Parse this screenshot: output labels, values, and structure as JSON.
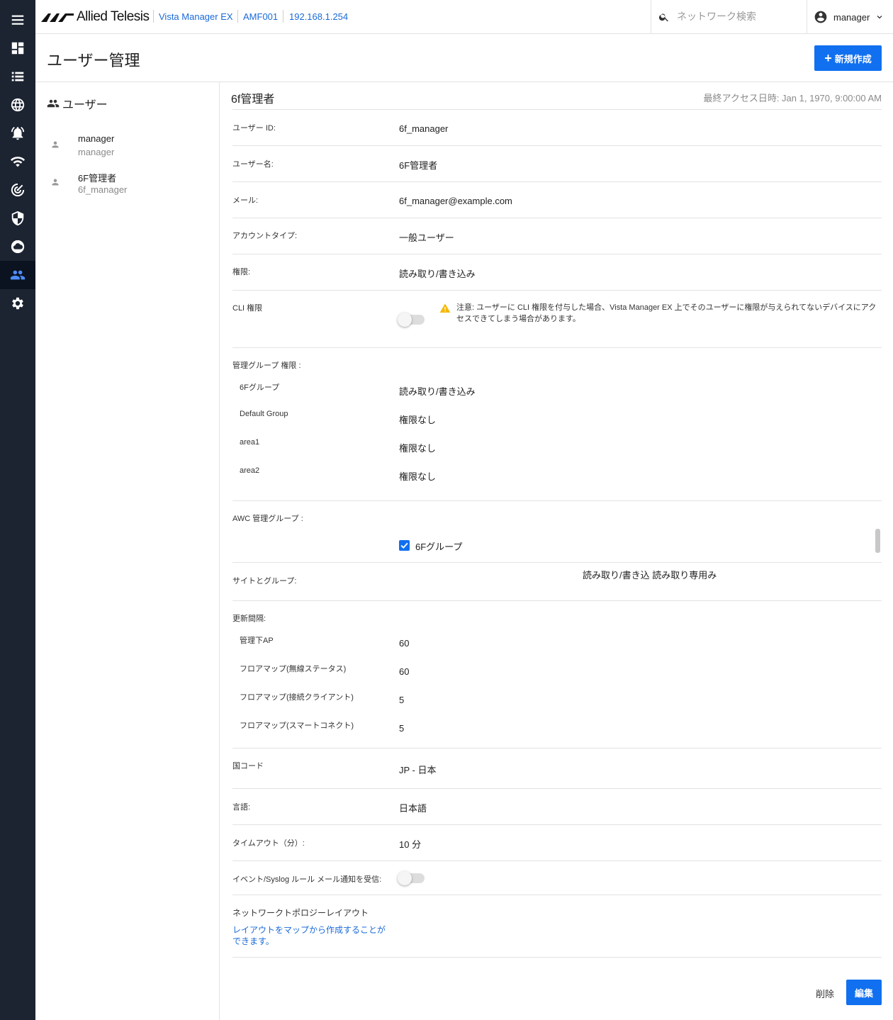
{
  "topbar": {
    "logo_text": "Allied Telesis",
    "crumbs": [
      "Vista Manager EX",
      "AMF001",
      "192.168.1.254"
    ],
    "search_placeholder": "ネットワーク検索",
    "user_name": "manager"
  },
  "page": {
    "title": "ユーザー管理",
    "new_button": "新規作成"
  },
  "user_list": {
    "header": "ユーザー",
    "items": [
      {
        "name": "manager",
        "id": "manager"
      },
      {
        "name": "6F管理者",
        "id": "6f_manager"
      }
    ]
  },
  "detail": {
    "title": "6f管理者",
    "last_access": "最終アクセス日時: Jan 1, 1970, 9:00:00 AM",
    "user_id_label": "ユーザー ID:",
    "user_id": "6f_manager",
    "user_name_label": "ユーザー名:",
    "user_name": "6F管理者",
    "mail_label": "メール:",
    "mail": "6f_manager@example.com",
    "account_type_label": "アカウントタイプ:",
    "account_type": "一般ユーザー",
    "permission_label": "権限:",
    "permission": "読み取り/書き込み",
    "cli_label": "CLI 権限",
    "cli_warning": "注意: ユーザーに CLI 権限を付与した場合、Vista Manager EX 上でそのユーザーに権限が与えられてないデバイスにアクセスできてしまう場合があります。",
    "mgmt_group_label": "管理グループ 権限 :",
    "mgmt_groups": [
      {
        "name": "6Fグループ",
        "value": "読み取り/書き込み"
      },
      {
        "name": "Default Group",
        "value": "権限なし"
      },
      {
        "name": "area1",
        "value": "権限なし"
      },
      {
        "name": "area2",
        "value": "権限なし"
      }
    ],
    "awc_label": "AWC 管理グループ :",
    "awc_group": "6Fグループ",
    "sites_label": "サイトとグループ:",
    "sites_value": "読み取り/書き込 読み取り専用み",
    "update_label": "更新間隔:",
    "update_items": [
      {
        "name": "管理下AP",
        "value": "60"
      },
      {
        "name": "フロアマップ(無線ステータス)",
        "value": "60"
      },
      {
        "name": "フロアマップ(接続クライアント)",
        "value": "5"
      },
      {
        "name": "フロアマップ(スマートコネクト)",
        "value": "5"
      }
    ],
    "country_label": "国コード",
    "country": "JP - 日本",
    "language_label": "言語:",
    "language": "日本語",
    "timeout_label": "タイムアウト（分）:",
    "timeout": "10 分",
    "event_label": "イベント/Syslog ルール メール通知を受信:",
    "topology_label": "ネットワークトポロジーレイアウト",
    "topology_link": "レイアウトをマップから作成することができます。",
    "delete_button": "削除",
    "edit_button": "編集"
  },
  "colors": {
    "accent": "#1170f0",
    "rail": "#1c2331",
    "link": "#1a6ad8",
    "warning": "#f5b800"
  }
}
